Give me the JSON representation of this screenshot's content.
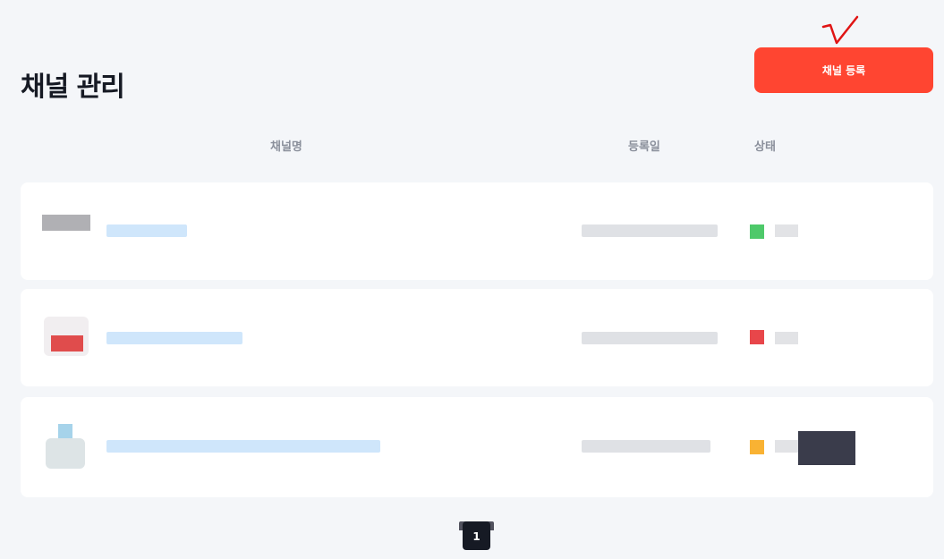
{
  "page": {
    "title": "채널 관리"
  },
  "toolbar": {
    "register_label": "채널 등록"
  },
  "table": {
    "headers": {
      "name": "채널명",
      "date": "등록일",
      "status": "상태"
    }
  },
  "rows": [
    {
      "status_color": "#4ec96a"
    },
    {
      "status_color": "#e8464a"
    },
    {
      "status_color": "#f9b233"
    }
  ],
  "pagination": {
    "current": "1"
  },
  "colors": {
    "accent": "#ff4531",
    "background": "#f4f6f9",
    "text_dark": "#161a24"
  }
}
